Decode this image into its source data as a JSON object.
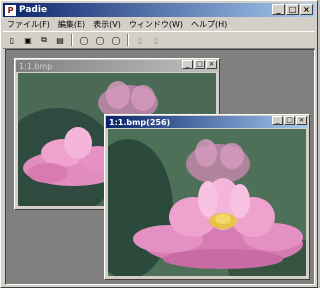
{
  "app": {
    "title": "Padie",
    "window_buttons": [
      "_",
      "□",
      "×"
    ]
  },
  "menu": [
    "ファイル(F)",
    "編集(E)",
    "表示(V)",
    "ウィンドウ(W)",
    "ヘルプ(H)"
  ],
  "toolbar": {
    "buttons": [
      {
        "icon": "new-file-icon",
        "glyph": "▯",
        "enabled": true
      },
      {
        "icon": "open-image-icon",
        "glyph": "▣",
        "enabled": true
      },
      {
        "icon": "copy-image-icon",
        "glyph": "⧉",
        "enabled": true
      },
      {
        "icon": "paste-image-icon",
        "glyph": "▤",
        "enabled": true
      },
      {
        "icon": "circle-tool-icon-1",
        "glyph": "◯",
        "enabled": true
      },
      {
        "icon": "circle-tool-icon-2",
        "glyph": "◯",
        "enabled": true
      },
      {
        "icon": "circle-tool-icon-3",
        "glyph": "◯",
        "enabled": true
      },
      {
        "icon": "disabled-tool-icon-1",
        "glyph": "▯",
        "enabled": false
      },
      {
        "icon": "disabled-tool-icon-2",
        "glyph": "▯",
        "enabled": false
      }
    ]
  },
  "windows": [
    {
      "title": "1:1.bmp",
      "state": "inactive"
    },
    {
      "title": "1:1.bmp(256)",
      "state": "active"
    }
  ],
  "colors": {
    "active_title": "#0a246a",
    "inactive_title": "#808080",
    "workspace": "#808080"
  }
}
